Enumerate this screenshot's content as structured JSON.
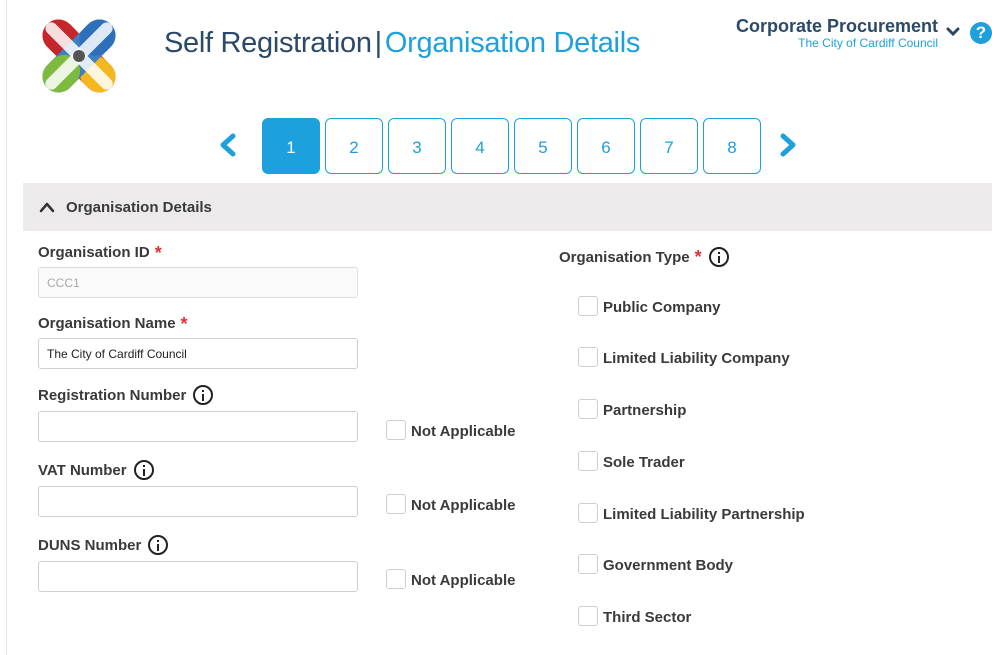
{
  "header": {
    "title_main": "Self Registration",
    "title_separator": "|",
    "title_section": "Organisation Details",
    "org_name": "Corporate Procurement",
    "org_council": "The City of Cardiff Council",
    "help_glyph": "?"
  },
  "stepper": {
    "steps": [
      "1",
      "2",
      "3",
      "4",
      "5",
      "6",
      "7",
      "8"
    ],
    "active_step": "1"
  },
  "section": {
    "title": "Organisation Details"
  },
  "form": {
    "org_id": {
      "label": "Organisation ID",
      "value": "CCC1"
    },
    "org_name": {
      "label": "Organisation Name",
      "value": "The City of Cardiff Council"
    },
    "reg_number": {
      "label": "Registration Number",
      "value": "",
      "na_label": "Not Applicable"
    },
    "vat_number": {
      "label": "VAT Number",
      "value": "",
      "na_label": "Not Applicable"
    },
    "duns_number": {
      "label": "DUNS Number",
      "value": "",
      "na_label": "Not Applicable"
    },
    "org_type": {
      "label": "Organisation Type",
      "options": [
        "Public Company",
        "Limited Liability Company",
        "Partnership",
        "Sole Trader",
        "Limited Liability Partnership",
        "Government Body",
        "Third Sector"
      ]
    }
  },
  "colors": {
    "accent": "#1da1dc",
    "title_dark": "#2b4a6a",
    "required": "#e0303a",
    "section_bg": "#eceaea"
  }
}
